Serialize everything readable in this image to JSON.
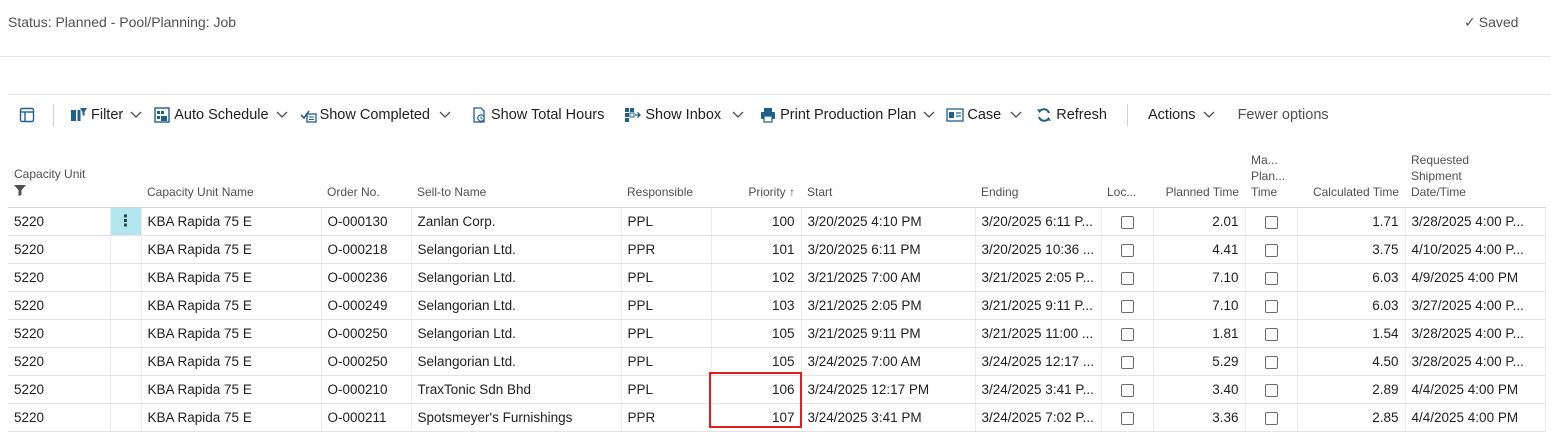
{
  "status": {
    "text": "Status: Planned - Pool/Planning: Job",
    "saved_label": "Saved",
    "check_icon": "check-icon"
  },
  "toolbar": {
    "filter": "Filter",
    "auto_schedule": "Auto Schedule",
    "show_completed": "Show Completed",
    "show_total_hours": "Show Total Hours",
    "show_inbox": "Show Inbox",
    "print_production_plan": "Print Production Plan",
    "case": "Case",
    "refresh": "Refresh",
    "actions": "Actions",
    "fewer_options": "Fewer options"
  },
  "columns": {
    "capacity_unit": "Capacity Unit",
    "capacity_unit_name": "Capacity Unit Name",
    "order_no": "Order No.",
    "sell_to_name": "Sell-to Name",
    "responsible": "Responsible",
    "priority": "Priority",
    "priority_sort": "↑",
    "start": "Start",
    "ending": "Ending",
    "loc": "Loc...",
    "planned_time": "Planned Time",
    "manual_planned_time_1": "Ma...",
    "manual_planned_time_2": "Plan...",
    "manual_planned_time_3": "Time",
    "calculated_time": "Calculated Time",
    "requested_1": "Requested",
    "requested_2": "Shipment",
    "requested_3": "Date/Time"
  },
  "rows": [
    {
      "capacity_unit": "5220",
      "name": "KBA Rapida 75 E",
      "order": "O-000130",
      "sell_to": "Zanlan Corp.",
      "responsible": "PPL",
      "priority": "100",
      "start": "3/20/2025 4:10 PM",
      "ending": "3/20/2025 6:11 P...",
      "planned": "2.01",
      "calculated": "1.71",
      "requested": "3/28/2025 4:00 P..."
    },
    {
      "capacity_unit": "5220",
      "name": "KBA Rapida 75 E",
      "order": "O-000218",
      "sell_to": "Selangorian Ltd.",
      "responsible": "PPR",
      "priority": "101",
      "start": "3/20/2025 6:11 PM",
      "ending": "3/20/2025 10:36 ...",
      "planned": "4.41",
      "calculated": "3.75",
      "requested": "4/10/2025 4:00 P..."
    },
    {
      "capacity_unit": "5220",
      "name": "KBA Rapida 75 E",
      "order": "O-000236",
      "sell_to": "Selangorian Ltd.",
      "responsible": "PPL",
      "priority": "102",
      "start": "3/21/2025 7:00 AM",
      "ending": "3/21/2025 2:05 P...",
      "planned": "7.10",
      "calculated": "6.03",
      "requested": "4/9/2025 4:00 PM"
    },
    {
      "capacity_unit": "5220",
      "name": "KBA Rapida 75 E",
      "order": "O-000249",
      "sell_to": "Selangorian Ltd.",
      "responsible": "PPL",
      "priority": "103",
      "start": "3/21/2025 2:05 PM",
      "ending": "3/21/2025 9:11 P...",
      "planned": "7.10",
      "calculated": "6.03",
      "requested": "3/27/2025 4:00 P..."
    },
    {
      "capacity_unit": "5220",
      "name": "KBA Rapida 75 E",
      "order": "O-000250",
      "sell_to": "Selangorian Ltd.",
      "responsible": "PPL",
      "priority": "105",
      "start": "3/21/2025 9:11 PM",
      "ending": "3/21/2025 11:00 ...",
      "planned": "1.81",
      "calculated": "1.54",
      "requested": "3/28/2025 4:00 P..."
    },
    {
      "capacity_unit": "5220",
      "name": "KBA Rapida 75 E",
      "order": "O-000250",
      "sell_to": "Selangorian Ltd.",
      "responsible": "PPL",
      "priority": "105",
      "start": "3/24/2025 7:00 AM",
      "ending": "3/24/2025 12:17 ...",
      "planned": "5.29",
      "calculated": "4.50",
      "requested": "3/28/2025 4:00 P..."
    },
    {
      "capacity_unit": "5220",
      "name": "KBA Rapida 75 E",
      "order": "O-000210",
      "sell_to": "TraxTonic Sdn Bhd",
      "responsible": "PPL",
      "priority": "106",
      "start": "3/24/2025 12:17 PM",
      "ending": "3/24/2025 3:41 P...",
      "planned": "3.40",
      "calculated": "2.89",
      "requested": "4/4/2025 4:00 PM"
    },
    {
      "capacity_unit": "5220",
      "name": "KBA Rapida 75 E",
      "order": "O-000211",
      "sell_to": "Spotsmeyer's Furnishings",
      "responsible": "PPR",
      "priority": "107",
      "start": "3/24/2025 3:41 PM",
      "ending": "3/24/2025 7:02 P...",
      "planned": "3.36",
      "calculated": "2.85",
      "requested": "4/4/2025 4:00 PM"
    }
  ],
  "row_menu_icon": "more-vertical-icon"
}
